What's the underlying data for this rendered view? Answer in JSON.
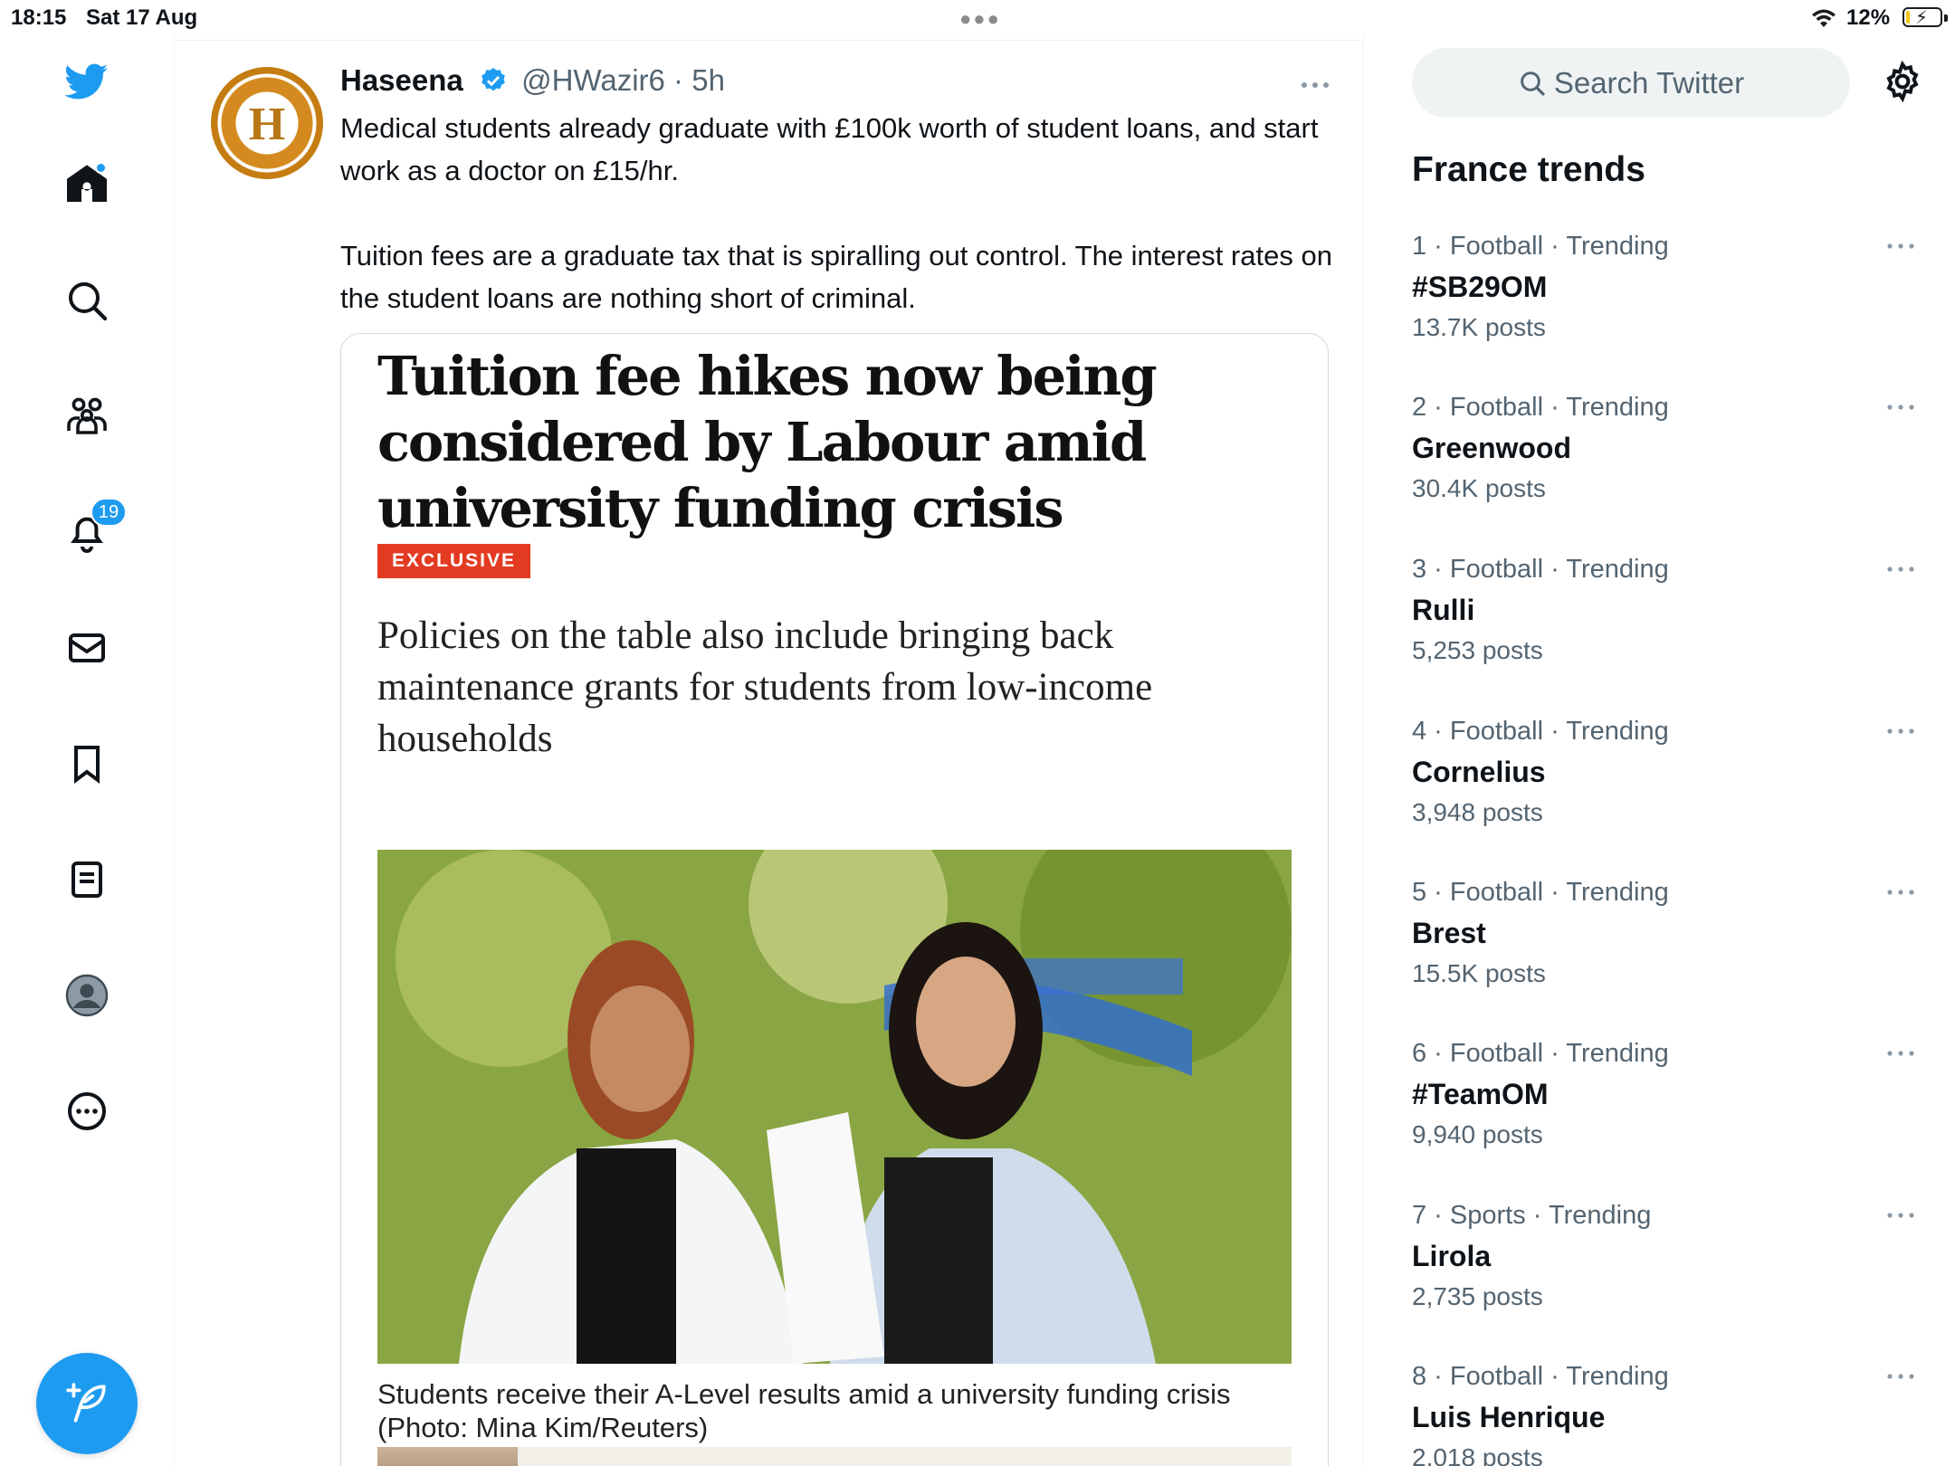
{
  "status_bar": {
    "time": "18:15",
    "date": "Sat 17 Aug",
    "battery": "12%",
    "battery_level": 0.12
  },
  "nav": {
    "items": [
      {
        "name": "home",
        "icon": "home-icon"
      },
      {
        "name": "explore",
        "icon": "search-icon"
      },
      {
        "name": "communities",
        "icon": "communities-icon"
      },
      {
        "name": "notifications",
        "icon": "bell-icon",
        "badge": "19"
      },
      {
        "name": "messages",
        "icon": "mail-icon"
      },
      {
        "name": "bookmarks",
        "icon": "bookmark-icon"
      },
      {
        "name": "lists",
        "icon": "list-icon"
      },
      {
        "name": "profile",
        "icon": "avatar-icon"
      },
      {
        "name": "more",
        "icon": "more-circle-icon"
      }
    ],
    "compose_icon": "feather-plus-icon"
  },
  "tweet": {
    "display_name": "Haseena",
    "handle": "@HWazir6 · 5h",
    "avatar_letter": "H",
    "text": "Medical students already graduate with £100k worth of student loans, and start work as a doctor on £15/hr.\n\nTuition fees are a graduate tax that is spiralling out control. The interest rates on the student loans are nothing short of criminal.",
    "card": {
      "headline": "Tuition fee hikes now being considered by Labour amid university funding crisis",
      "tag": "EXCLUSIVE",
      "standfirst": "Policies on the table also include bringing back maintenance grants for students from low-income households",
      "caption": "Students receive their A-Level results amid a university funding crisis (Photo: Mina Kim/Reuters)"
    }
  },
  "sidebar": {
    "search_placeholder": "Search Twitter",
    "trends_title": "France trends",
    "trends": [
      {
        "context": "1 · Football · Trending",
        "topic": "#SB29OM",
        "posts": "13.7K posts"
      },
      {
        "context": "2 · Football · Trending",
        "topic": "Greenwood",
        "posts": "30.4K posts"
      },
      {
        "context": "3 · Football · Trending",
        "topic": "Rulli",
        "posts": "5,253 posts"
      },
      {
        "context": "4 · Football · Trending",
        "topic": "Cornelius",
        "posts": "3,948 posts"
      },
      {
        "context": "5 · Football · Trending",
        "topic": "Brest",
        "posts": "15.5K posts"
      },
      {
        "context": "6 · Football · Trending",
        "topic": "#TeamOM",
        "posts": "9,940 posts"
      },
      {
        "context": "7 · Sports · Trending",
        "topic": "Lirola",
        "posts": "2,735 posts"
      },
      {
        "context": "8 · Football · Trending",
        "topic": "Luis Henrique",
        "posts": "2,018 posts"
      }
    ]
  },
  "colors": {
    "accent": "#1d9bf0",
    "text": "#0f1419",
    "muted": "#536471",
    "exclusive": "#e33b22"
  }
}
